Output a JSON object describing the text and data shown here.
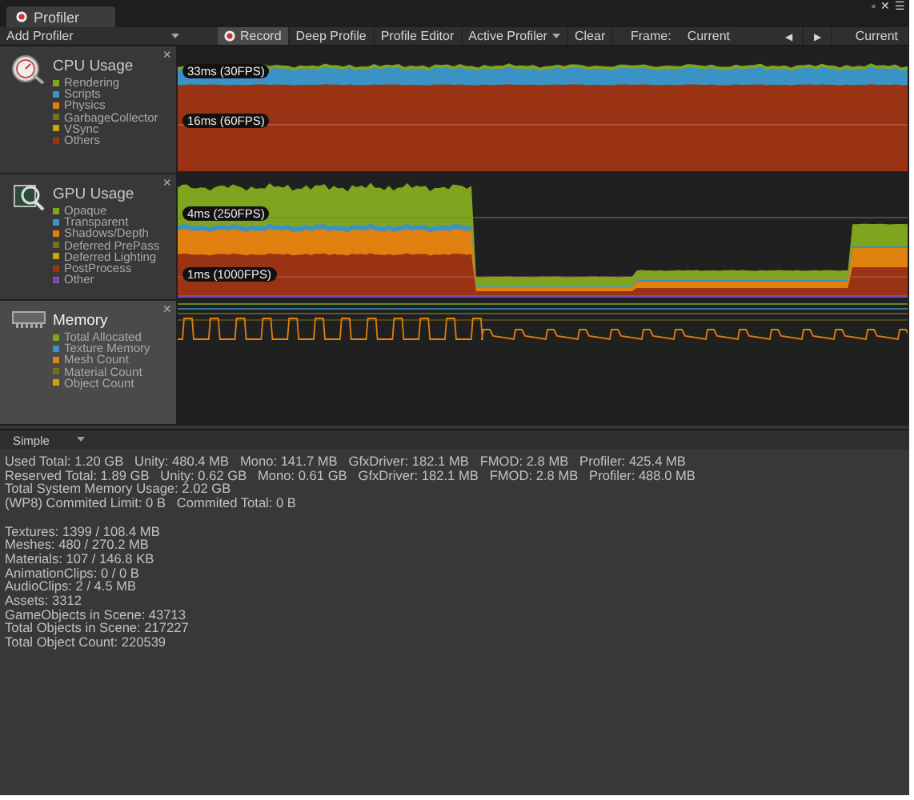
{
  "window": {
    "tab": "Profiler",
    "controls": [
      "▫",
      "✕",
      "☰"
    ]
  },
  "toolbar": {
    "add_profiler": "Add Profiler",
    "buttons": [
      {
        "label": "Record",
        "on": true,
        "kind": "record"
      },
      {
        "label": "Deep Profile",
        "on": false,
        "kind": "plain"
      },
      {
        "label": "Profile Editor",
        "on": false,
        "kind": "plain"
      },
      {
        "label": "Active Profiler",
        "on": false,
        "kind": "dropdown"
      },
      {
        "label": "Clear",
        "on": false,
        "kind": "plain"
      }
    ],
    "frame_label": "Frame:",
    "frame_value": "Current",
    "prev": "◀",
    "next": "▶",
    "current": "Current"
  },
  "profilers": [
    {
      "kind": "cpu",
      "title": "CPU Usage",
      "selected": false,
      "close": "×",
      "legend": [
        {
          "label": "Rendering",
          "color": "#7fa51e"
        },
        {
          "label": "Scripts",
          "color": "#3a93c4"
        },
        {
          "label": "Physics",
          "color": "#e0800e"
        },
        {
          "label": "GarbageCollector",
          "color": "#70701c"
        },
        {
          "label": "VSync",
          "color": "#c9a50a"
        },
        {
          "label": "Others",
          "color": "#9a3214"
        }
      ],
      "markers": [
        "33ms (30FPS)",
        "16ms (60FPS)"
      ]
    },
    {
      "kind": "gpu",
      "title": "GPU Usage",
      "selected": false,
      "close": "×",
      "legend": [
        {
          "label": "Opaque",
          "color": "#7fa51e"
        },
        {
          "label": "Transparent",
          "color": "#3a93c4"
        },
        {
          "label": "Shadows/Depth",
          "color": "#e0800e"
        },
        {
          "label": "Deferred PrePass",
          "color": "#70701c"
        },
        {
          "label": "Deferred Lighting",
          "color": "#c9a50a"
        },
        {
          "label": "PostProcess",
          "color": "#9a3214"
        },
        {
          "label": "Other",
          "color": "#7a4bb0"
        }
      ],
      "markers": [
        "4ms (250FPS)",
        "1ms (1000FPS)"
      ]
    },
    {
      "kind": "memory",
      "title": "Memory",
      "selected": true,
      "close": "×",
      "legend": [
        {
          "label": "Total Allocated",
          "color": "#7fa51e"
        },
        {
          "label": "Texture Memory",
          "color": "#3a93c4"
        },
        {
          "label": "Mesh Count",
          "color": "#e0800e"
        },
        {
          "label": "Material Count",
          "color": "#70701c"
        },
        {
          "label": "Object Count",
          "color": "#c9a50a"
        }
      ]
    }
  ],
  "detail": {
    "mode": "Simple",
    "groups": [
      [
        "Used Total: 1.20 GB   Unity: 480.4 MB   Mono: 141.7 MB   GfxDriver: 182.1 MB   FMOD: 2.8 MB   Profiler: 425.4 MB",
        "Reserved Total: 1.89 GB   Unity: 0.62 GB   Mono: 0.61 GB   GfxDriver: 182.1 MB   FMOD: 2.8 MB   Profiler: 488.0 MB",
        "Total System Memory Usage: 2.02 GB",
        "(WP8) Commited Limit: 0 B   Commited Total: 0 B"
      ],
      [
        "Textures: 1399 / 108.4 MB",
        "Meshes: 480 / 270.2 MB",
        "Materials: 107 / 146.8 KB",
        "AnimationClips: 0 / 0 B",
        "AudioClips: 2 / 4.5 MB",
        "Assets: 3312",
        "GameObjects in Scene: 43713",
        "Total Objects in Scene: 217227",
        "Total Object Count: 220539"
      ]
    ]
  }
}
